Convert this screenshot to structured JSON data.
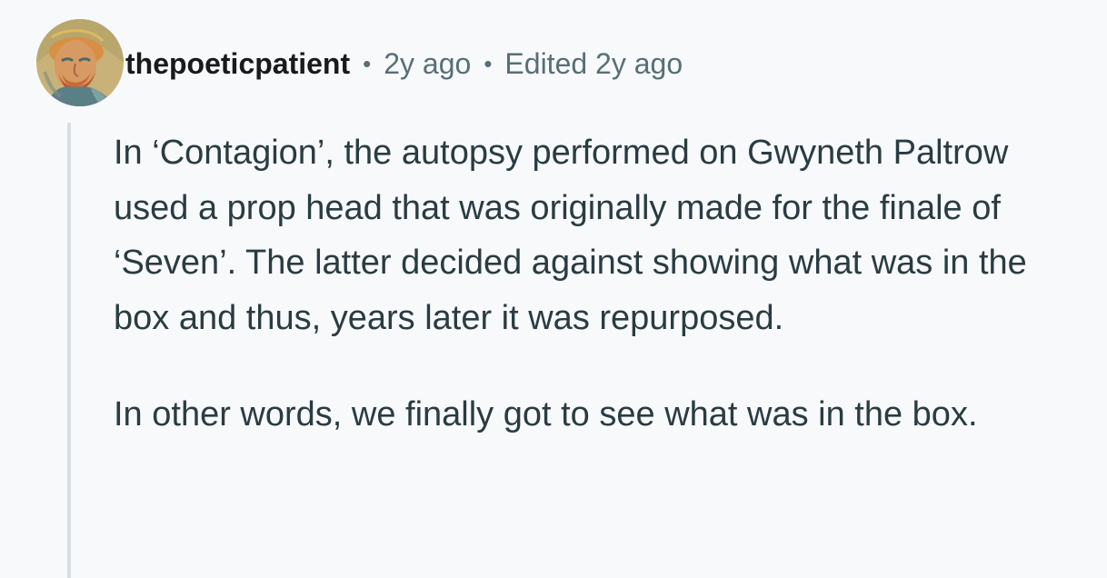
{
  "comment": {
    "author": "thepoeticpatient",
    "separator": "•",
    "timestamp": "2y ago",
    "edited": "Edited 2y ago",
    "paragraphs": [
      "In ‘Contagion’, the autopsy performed on Gwyneth Paltrow used a prop head that was originally made for the finale of ‘Seven’. The latter decided against showing what was in the box and thus, years later it was repurposed.",
      "In other words, we finally got to see what was in the box."
    ]
  },
  "avatar": {
    "icon": "painted-portrait-avatar",
    "colors": {
      "background": "#c9b27a",
      "face": "#d89a63",
      "beard": "#b8562c",
      "jacket": "#5b7f86"
    }
  },
  "colors": {
    "page_background": "#f8f9fb",
    "username": "#1a1a1b",
    "meta_text": "#576f76",
    "body_text": "#2a3c42",
    "thread_line": "#d7dfe3"
  }
}
